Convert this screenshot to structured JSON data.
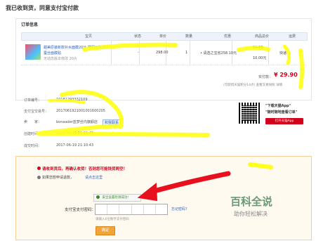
{
  "page": {
    "title": "我已收到货，同意支付宝付款"
  },
  "order": {
    "section_title": "订单信息",
    "columns": [
      "宝贝",
      "状态",
      "单价",
      "数量",
      "优惠",
      "商品总价",
      "运费"
    ],
    "product": {
      "name_line1": "甜美原装新款补水面膜20片 睡眠面膜保湿",
      "name_line2": "蚕丝面膜贴",
      "name_line3": "无动态版本修改 20片",
      "status": "-",
      "unit_price": "298.00",
      "quantity": "1",
      "discount": "• 请选之宝省258.10元",
      "subtotal_strike": "39.90",
      "subtotal": "10.00元",
      "shipping": "快递："
    },
    "paid_label": "实付款：",
    "paid_amount": "¥ 29.90",
    "paid_note": "(可获得天猫积分14点) 查看交易快照 详情"
  },
  "details": {
    "order_no_label": "订单编号：",
    "order_no_value": "10181293332109",
    "alipay_label": "支付宝交易号：",
    "alipay_value": "2017061921001001600205",
    "seller_label": "卖　　家：",
    "seller_value": "bonaader蓝梦丝内旗舰店",
    "contact_label": "和我联系",
    "created_label": "创建时间：",
    "created_value": "2017-06-19 21:10:43",
    "deal_label": "成交时间：",
    "deal_value": "2017-06-19 21:10:43"
  },
  "app_promo": {
    "line1": "\"下载天猫App\"",
    "line2": "\"随时随地查看订单\"",
    "button": "打开天猫App"
  },
  "confirm": {
    "warning": "请收到货后，再确认收货！否则您可能钱货两空！",
    "info_text": "如果您想申请退款，",
    "info_link": "请点击这里",
    "secure_text": "安全设置检测成功!",
    "password_label": "支付宝支付密码：",
    "forgot_link": "忘记密码?",
    "password_hint": "请输入6位数字支付密码",
    "submit_label": "确定"
  },
  "watermark": {
    "title": "百科全说",
    "subtitle": "助你轻松解决"
  },
  "colors": {
    "accent_red": "#d3001a",
    "highlighter": "#ffff1a",
    "confirm_orange": "#f3a33c",
    "link_blue": "#2a64c5"
  }
}
